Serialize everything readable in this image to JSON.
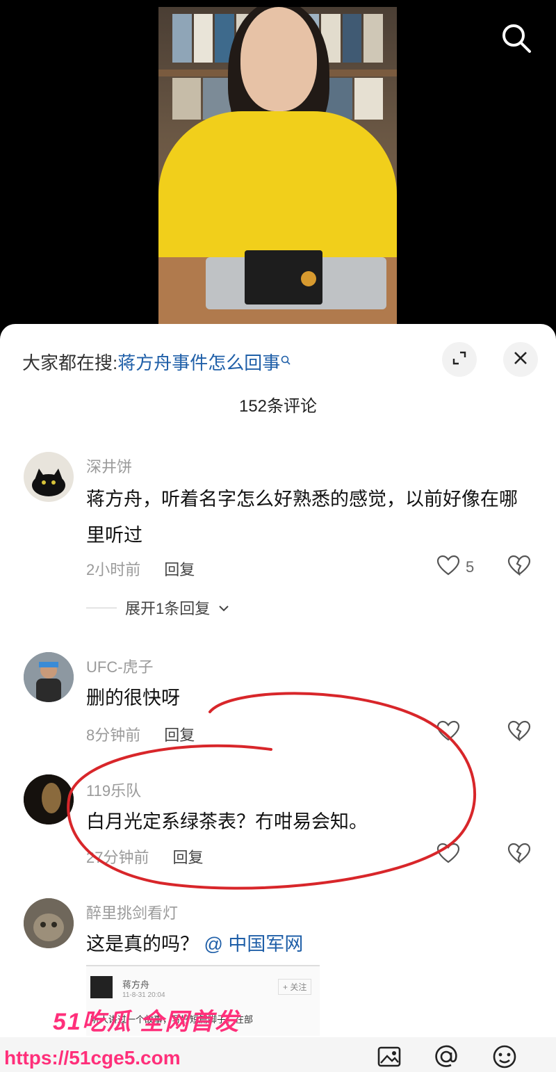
{
  "video": {
    "search_icon": "search-icon"
  },
  "sheet": {
    "hot_search_prefix": "大家都在搜:",
    "hot_search_link": "蒋方舟事件怎么回事",
    "comment_count": "152条评论",
    "icons": {
      "expand": "expand-icon",
      "close": "close-icon"
    }
  },
  "comments": [
    {
      "name": "深井饼",
      "text": "蒋方舟，听着名字怎么好熟悉的感觉，以前好像在哪里听过",
      "time": "2小时前",
      "reply": "回复",
      "likes": "5",
      "expand": "展开1条回复"
    },
    {
      "name": "UFC-虎子",
      "text": "删的很快呀",
      "time": "8分钟前",
      "reply": "回复"
    },
    {
      "name": "119乐队",
      "text": "白月光定系绿茶表？冇咁易会知。",
      "time": "27分钟前",
      "reply": "回复"
    },
    {
      "name": "醉里挑剑看灯",
      "text": "这是真的吗？",
      "mention": "@ 中国军网",
      "embed": {
        "author": "蒋方舟",
        "follow": "+ 关注",
        "time": "11-8-31 20:04",
        "snippet": "听人讲过一个故事，写好短篇脚子。在部"
      }
    }
  ],
  "watermark": {
    "brand": "51吃瓜 全网首发",
    "url": "https://51cge5.com"
  },
  "colors": {
    "accent": "#1f5fa8",
    "watermark": "#ff2f7a",
    "annotation": "#d8262a"
  }
}
